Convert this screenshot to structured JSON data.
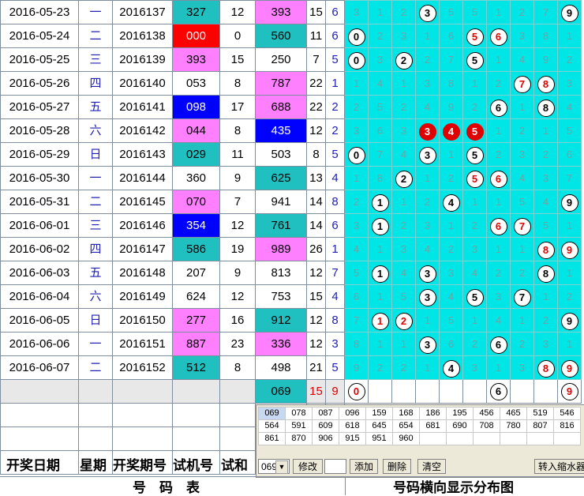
{
  "rows": [
    {
      "date": "2016-05-23",
      "week": "一",
      "issue": "2016137",
      "test": "327",
      "test_bg": "#20c0c0",
      "sum": "12",
      "draw": "393",
      "draw_bg": "#ff80ff",
      "span": "15",
      "last": "6",
      "dist": [
        {
          "t": "3"
        },
        {
          "t": "1"
        },
        {
          "t": "2"
        },
        {
          "t": "3",
          "c": "w"
        },
        {
          "t": "5"
        },
        {
          "t": "5"
        },
        {
          "t": "1"
        },
        {
          "t": "2"
        },
        {
          "t": "7"
        },
        {
          "t": "9",
          "c": "w"
        }
      ]
    },
    {
      "date": "2016-05-24",
      "week": "二",
      "issue": "2016138",
      "test": "000",
      "test_bg": "#ff0000",
      "test_fg": "#ffffff",
      "sum": "0",
      "draw": "560",
      "draw_bg": "#20c0c0",
      "span": "11",
      "last": "6",
      "dist": [
        {
          "t": "0",
          "c": "w"
        },
        {
          "t": "2"
        },
        {
          "t": "3"
        },
        {
          "t": "1"
        },
        {
          "t": "6"
        },
        {
          "t": "5",
          "c": "r"
        },
        {
          "t": "6",
          "c": "r"
        },
        {
          "t": "3"
        },
        {
          "t": "8"
        },
        {
          "t": "1"
        }
      ]
    },
    {
      "date": "2016-05-25",
      "week": "三",
      "issue": "2016139",
      "test": "393",
      "test_bg": "#ff80ff",
      "sum": "15",
      "draw": "250",
      "draw_bg": "#ffffff",
      "span": "7",
      "last": "5",
      "dist": [
        {
          "t": "0",
          "c": "w"
        },
        {
          "t": "3"
        },
        {
          "t": "2",
          "c": "w"
        },
        {
          "t": "2"
        },
        {
          "t": "7"
        },
        {
          "t": "5",
          "c": "w"
        },
        {
          "t": "1"
        },
        {
          "t": "4"
        },
        {
          "t": "9"
        },
        {
          "t": "2"
        }
      ]
    },
    {
      "date": "2016-05-26",
      "week": "四",
      "issue": "2016140",
      "test": "053",
      "test_bg": "#ffffff",
      "sum": "8",
      "draw": "787",
      "draw_bg": "#ff80ff",
      "span": "22",
      "last": "1",
      "dist": [
        {
          "t": "1"
        },
        {
          "t": "4"
        },
        {
          "t": "1"
        },
        {
          "t": "3"
        },
        {
          "t": "8"
        },
        {
          "t": "1"
        },
        {
          "t": "2"
        },
        {
          "t": "7",
          "c": "r"
        },
        {
          "t": "8",
          "c": "r"
        },
        {
          "t": "3"
        }
      ]
    },
    {
      "date": "2016-05-27",
      "week": "五",
      "issue": "2016141",
      "test": "098",
      "test_bg": "#0000ff",
      "test_fg": "#ffffff",
      "sum": "17",
      "draw": "688",
      "draw_bg": "#ff80ff",
      "span": "22",
      "last": "2",
      "dist": [
        {
          "t": "2"
        },
        {
          "t": "5"
        },
        {
          "t": "2"
        },
        {
          "t": "4"
        },
        {
          "t": "9"
        },
        {
          "t": "2"
        },
        {
          "t": "6",
          "c": "w"
        },
        {
          "t": "1"
        },
        {
          "t": "8",
          "c": "w"
        },
        {
          "t": "4"
        }
      ]
    },
    {
      "date": "2016-05-28",
      "week": "六",
      "issue": "2016142",
      "test": "044",
      "test_bg": "#ff80ff",
      "sum": "8",
      "draw": "435",
      "draw_bg": "#0000ff",
      "draw_fg": "#ffffff",
      "span": "12",
      "last": "2",
      "dist": [
        {
          "t": "3"
        },
        {
          "t": "6"
        },
        {
          "t": "3"
        },
        {
          "t": "3",
          "c": "f"
        },
        {
          "t": "4",
          "c": "f"
        },
        {
          "t": "5",
          "c": "f"
        },
        {
          "t": "1"
        },
        {
          "t": "2"
        },
        {
          "t": "1"
        },
        {
          "t": "5"
        }
      ]
    },
    {
      "date": "2016-05-29",
      "week": "日",
      "issue": "2016143",
      "test": "029",
      "test_bg": "#20c0c0",
      "sum": "11",
      "draw": "503",
      "draw_bg": "#ffffff",
      "span": "8",
      "last": "5",
      "dist": [
        {
          "t": "0",
          "c": "w"
        },
        {
          "t": "7"
        },
        {
          "t": "4"
        },
        {
          "t": "3",
          "c": "w"
        },
        {
          "t": "1"
        },
        {
          "t": "5",
          "c": "w"
        },
        {
          "t": "2"
        },
        {
          "t": "3"
        },
        {
          "t": "2"
        },
        {
          "t": "6"
        }
      ]
    },
    {
      "date": "2016-05-30",
      "week": "一",
      "issue": "2016144",
      "test": "360",
      "test_bg": "#ffffff",
      "sum": "9",
      "draw": "625",
      "draw_bg": "#20c0c0",
      "span": "13",
      "last": "4",
      "dist": [
        {
          "t": "1"
        },
        {
          "t": "8"
        },
        {
          "t": "2",
          "c": "w"
        },
        {
          "t": "1"
        },
        {
          "t": "2"
        },
        {
          "t": "5",
          "c": "r"
        },
        {
          "t": "6",
          "c": "r"
        },
        {
          "t": "4"
        },
        {
          "t": "3"
        },
        {
          "t": "7"
        }
      ]
    },
    {
      "date": "2016-05-31",
      "week": "二",
      "issue": "2016145",
      "test": "070",
      "test_bg": "#ff80ff",
      "sum": "7",
      "draw": "941",
      "draw_bg": "#ffffff",
      "span": "14",
      "last": "8",
      "dist": [
        {
          "t": "2"
        },
        {
          "t": "1",
          "c": "w"
        },
        {
          "t": "1"
        },
        {
          "t": "2"
        },
        {
          "t": "4",
          "c": "w"
        },
        {
          "t": "1"
        },
        {
          "t": "1"
        },
        {
          "t": "5"
        },
        {
          "t": "4"
        },
        {
          "t": "9",
          "c": "w"
        }
      ]
    },
    {
      "date": "2016-06-01",
      "week": "三",
      "issue": "2016146",
      "test": "354",
      "test_bg": "#0000ff",
      "test_fg": "#ffffff",
      "sum": "12",
      "draw": "761",
      "draw_bg": "#20c0c0",
      "span": "14",
      "last": "6",
      "dist": [
        {
          "t": "3"
        },
        {
          "t": "1",
          "c": "w"
        },
        {
          "t": "2"
        },
        {
          "t": "3"
        },
        {
          "t": "1"
        },
        {
          "t": "2"
        },
        {
          "t": "6",
          "c": "r"
        },
        {
          "t": "7",
          "c": "r"
        },
        {
          "t": "5"
        },
        {
          "t": "1"
        }
      ]
    },
    {
      "date": "2016-06-02",
      "week": "四",
      "issue": "2016147",
      "test": "586",
      "test_bg": "#20c0c0",
      "sum": "19",
      "draw": "989",
      "draw_bg": "#ff80ff",
      "span": "26",
      "last": "1",
      "dist": [
        {
          "t": "4"
        },
        {
          "t": "1"
        },
        {
          "t": "3"
        },
        {
          "t": "4"
        },
        {
          "t": "2"
        },
        {
          "t": "3"
        },
        {
          "t": "1"
        },
        {
          "t": "1"
        },
        {
          "t": "8",
          "c": "r"
        },
        {
          "t": "9",
          "c": "r"
        }
      ]
    },
    {
      "date": "2016-06-03",
      "week": "五",
      "issue": "2016148",
      "test": "207",
      "test_bg": "#ffffff",
      "sum": "9",
      "draw": "813",
      "draw_bg": "#ffffff",
      "span": "12",
      "last": "7",
      "dist": [
        {
          "t": "5"
        },
        {
          "t": "1",
          "c": "w"
        },
        {
          "t": "4"
        },
        {
          "t": "3",
          "c": "w"
        },
        {
          "t": "3"
        },
        {
          "t": "4"
        },
        {
          "t": "2"
        },
        {
          "t": "2"
        },
        {
          "t": "8",
          "c": "w"
        },
        {
          "t": "1"
        }
      ]
    },
    {
      "date": "2016-06-04",
      "week": "六",
      "issue": "2016149",
      "test": "624",
      "test_bg": "#ffffff",
      "sum": "12",
      "draw": "753",
      "draw_bg": "#ffffff",
      "span": "15",
      "last": "4",
      "dist": [
        {
          "t": "6"
        },
        {
          "t": "1"
        },
        {
          "t": "5"
        },
        {
          "t": "3",
          "c": "w"
        },
        {
          "t": "4"
        },
        {
          "t": "5",
          "c": "w"
        },
        {
          "t": "3"
        },
        {
          "t": "7",
          "c": "w"
        },
        {
          "t": "1"
        },
        {
          "t": "2"
        }
      ]
    },
    {
      "date": "2016-06-05",
      "week": "日",
      "issue": "2016150",
      "test": "277",
      "test_bg": "#ff80ff",
      "sum": "16",
      "draw": "912",
      "draw_bg": "#20c0c0",
      "span": "12",
      "last": "8",
      "dist": [
        {
          "t": "7"
        },
        {
          "t": "1",
          "c": "r"
        },
        {
          "t": "2",
          "c": "r"
        },
        {
          "t": "1"
        },
        {
          "t": "5"
        },
        {
          "t": "1"
        },
        {
          "t": "4"
        },
        {
          "t": "1"
        },
        {
          "t": "2"
        },
        {
          "t": "9",
          "c": "w"
        }
      ]
    },
    {
      "date": "2016-06-06",
      "week": "一",
      "issue": "2016151",
      "test": "887",
      "test_bg": "#ff80ff",
      "sum": "23",
      "draw": "336",
      "draw_bg": "#ff80ff",
      "span": "12",
      "last": "3",
      "dist": [
        {
          "t": "8"
        },
        {
          "t": "1"
        },
        {
          "t": "1"
        },
        {
          "t": "3",
          "c": "w"
        },
        {
          "t": "6"
        },
        {
          "t": "2"
        },
        {
          "t": "6",
          "c": "w"
        },
        {
          "t": "2"
        },
        {
          "t": "3"
        },
        {
          "t": "1"
        }
      ]
    },
    {
      "date": "2016-06-07",
      "week": "二",
      "issue": "2016152",
      "test": "512",
      "test_bg": "#20c0c0",
      "sum": "8",
      "draw": "498",
      "draw_bg": "#ffffff",
      "span": "21",
      "last": "5",
      "dist": [
        {
          "t": "9"
        },
        {
          "t": "2"
        },
        {
          "t": "2"
        },
        {
          "t": "1"
        },
        {
          "t": "4",
          "c": "w"
        },
        {
          "t": "3"
        },
        {
          "t": "1"
        },
        {
          "t": "3"
        },
        {
          "t": "8",
          "c": "r"
        },
        {
          "t": "9",
          "c": "r"
        }
      ]
    }
  ],
  "forecast": {
    "draw": "069",
    "span": "15",
    "last": "9",
    "dist": [
      {
        "t": "0",
        "c": "r"
      },
      {
        "t": ""
      },
      {
        "t": ""
      },
      {
        "t": ""
      },
      {
        "t": ""
      },
      {
        "t": ""
      },
      {
        "t": "6",
        "c": "w"
      },
      {
        "t": ""
      },
      {
        "t": ""
      },
      {
        "t": "9",
        "c": "r"
      }
    ]
  },
  "headers": {
    "date": "开奖日期",
    "week": "星期",
    "issue": "开奖期号",
    "test": "试机号",
    "sum": "试和"
  },
  "footer": {
    "left": "号　码　表",
    "right": "号码横向显示分布图"
  },
  "panel": {
    "numbers": [
      "069",
      "078",
      "087",
      "096",
      "159",
      "168",
      "186",
      "195",
      "456",
      "465",
      "519",
      "546",
      "564",
      "591",
      "609",
      "618",
      "645",
      "654",
      "681",
      "690",
      "708",
      "780",
      "807",
      "816",
      "861",
      "870",
      "906",
      "915",
      "951",
      "960",
      "",
      "",
      "",
      "",
      "",
      ""
    ],
    "select_value": "069",
    "modify_label": "修改",
    "input_value": "",
    "add_label": "添加",
    "delete_label": "删除",
    "clear_label": "清空",
    "transfer_label": "转入缩水器"
  },
  "colors": {
    "cyan": "#00e5e5",
    "magenta": "#ff80ff",
    "teal": "#20c0c0",
    "blue": "#0000ff",
    "red": "#ff0000"
  }
}
